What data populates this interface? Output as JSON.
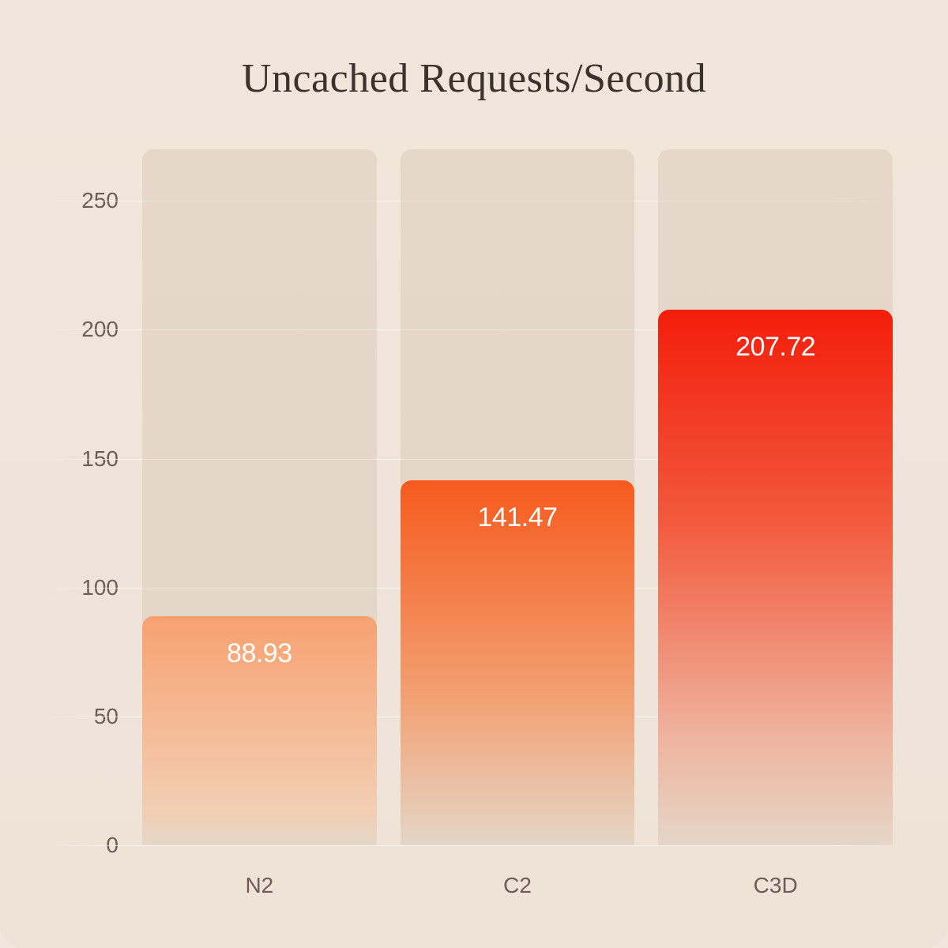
{
  "chart_data": {
    "type": "bar",
    "title": "Uncached Requests/Second",
    "categories": [
      "N2",
      "C2",
      "C3D"
    ],
    "values": [
      88.93,
      141.47,
      207.72
    ],
    "ylabel": "",
    "xlabel": "",
    "ylim": [
      0,
      270
    ],
    "yticks": [
      0,
      50,
      100,
      150,
      200,
      250
    ]
  }
}
